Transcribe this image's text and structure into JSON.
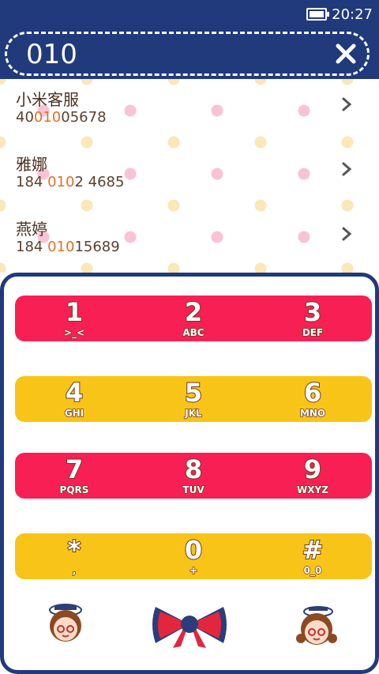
{
  "status_bar": {
    "time": "20:27",
    "battery_icon": "battery-icon"
  },
  "search": {
    "query": "010",
    "clear_icon": "close-icon"
  },
  "results": [
    {
      "name": "小米客服",
      "num_pre": "40",
      "num_hl": "010",
      "num_post": "05678"
    },
    {
      "name": "雅娜",
      "num_pre": "184 ",
      "num_hl": "010",
      "num_post": "2 4685"
    },
    {
      "name": "燕婷",
      "num_pre": "184 ",
      "num_hl": "010",
      "num_post": "15689"
    }
  ],
  "keypad": {
    "rows": [
      {
        "color": "pink",
        "keys": [
          {
            "digit": "1",
            "letters": ">_<"
          },
          {
            "digit": "2",
            "letters": "ABC"
          },
          {
            "digit": "3",
            "letters": "DEF"
          }
        ]
      },
      {
        "color": "yellow",
        "keys": [
          {
            "digit": "4",
            "letters": "GHI"
          },
          {
            "digit": "5",
            "letters": "JKL"
          },
          {
            "digit": "6",
            "letters": "MNO"
          }
        ]
      },
      {
        "color": "pink",
        "keys": [
          {
            "digit": "7",
            "letters": "PQRS"
          },
          {
            "digit": "8",
            "letters": "TUV"
          },
          {
            "digit": "9",
            "letters": "WXYZ"
          }
        ]
      },
      {
        "color": "yellow",
        "keys": [
          {
            "digit": "*",
            "letters": ","
          },
          {
            "digit": "0",
            "letters": "+"
          },
          {
            "digit": "#",
            "letters": "0_0"
          }
        ]
      }
    ]
  },
  "colors": {
    "navy": "#213a7c",
    "pink": "#f81f55",
    "yellow": "#f9c418",
    "highlight": "#e3702a"
  }
}
